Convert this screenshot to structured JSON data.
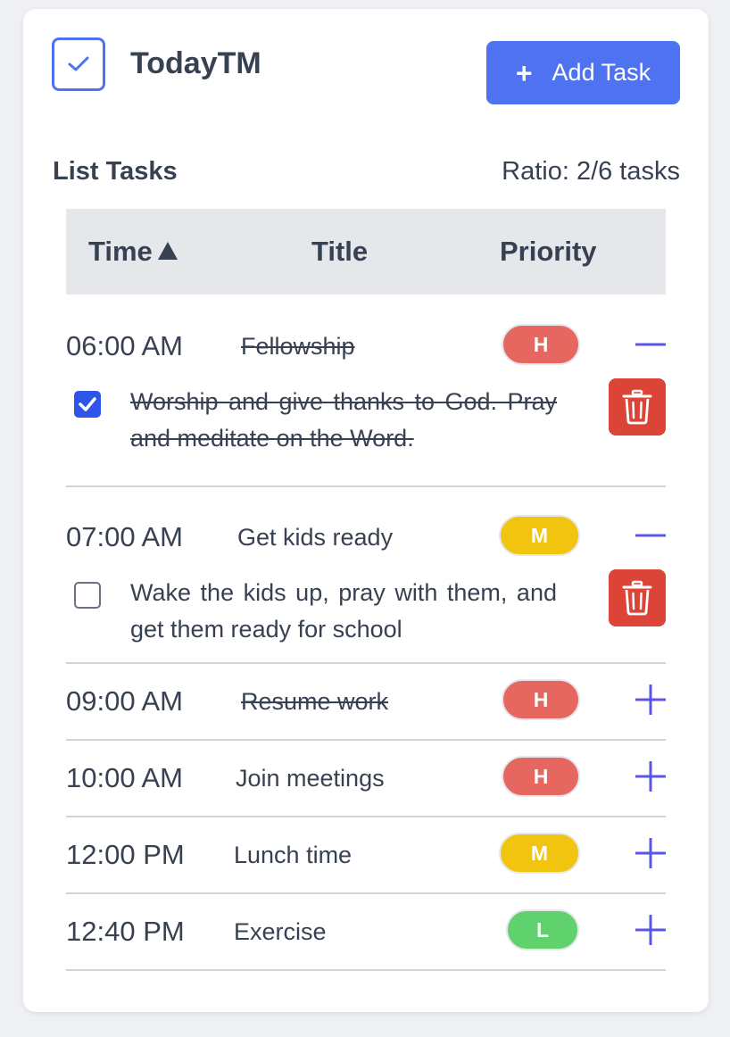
{
  "app": {
    "title": "TodayTM"
  },
  "header": {
    "add_task_label": "Add Task",
    "add_icon": "+"
  },
  "list": {
    "heading": "List Tasks",
    "ratio": "Ratio: 2/6 tasks"
  },
  "table": {
    "columns": [
      "Time",
      "Title",
      "Priority"
    ],
    "sort": {
      "column": "Time",
      "direction": "ascending"
    }
  },
  "colors": {
    "accent": "#4f73f0",
    "high": "#e5675f",
    "medium": "#f1c40f",
    "low": "#5fd16d",
    "delete": "#dc4437",
    "toggle": "#5b54e8"
  },
  "tasks": [
    {
      "time": "06:00 AM",
      "title": "Fellowship",
      "priority": "H",
      "done": true,
      "expanded": true,
      "description": "Worship and give thanks to God. Pray and meditate on the Word."
    },
    {
      "time": "07:00 AM",
      "title": "Get kids ready",
      "priority": "M",
      "done": false,
      "expanded": true,
      "description": "Wake the kids up, pray with them, and get them ready for school"
    },
    {
      "time": "09:00 AM",
      "title": "Resume work",
      "priority": "H",
      "done": true,
      "expanded": false
    },
    {
      "time": "10:00 AM",
      "title": "Join meetings",
      "priority": "H",
      "done": false,
      "expanded": false
    },
    {
      "time": "12:00 PM",
      "title": "Lunch time",
      "priority": "M",
      "done": false,
      "expanded": false
    },
    {
      "time": "12:40 PM",
      "title": "Exercise",
      "priority": "L",
      "done": false,
      "expanded": false
    }
  ]
}
